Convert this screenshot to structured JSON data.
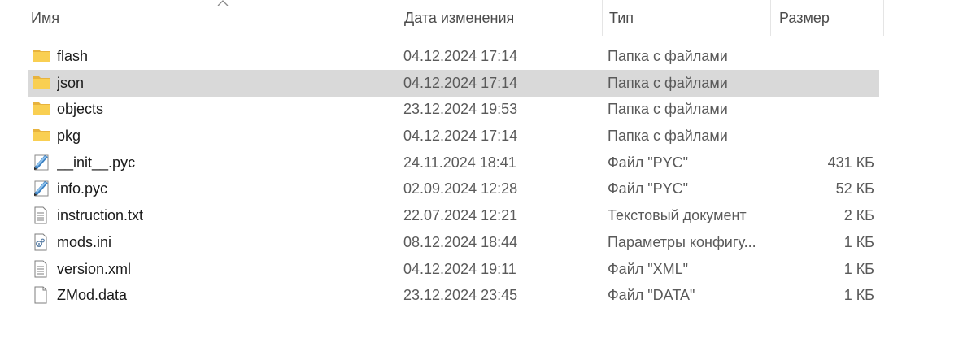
{
  "header": {
    "name": "Имя",
    "date": "Дата изменения",
    "type": "Тип",
    "size": "Размер"
  },
  "files": [
    {
      "name": "flash",
      "date": "04.12.2024 17:14",
      "type": "Папка с файлами",
      "size": "",
      "icon": "folder-icon",
      "selected": false
    },
    {
      "name": "json",
      "date": "04.12.2024 17:14",
      "type": "Папка с файлами",
      "size": "",
      "icon": "folder-icon",
      "selected": true
    },
    {
      "name": "objects",
      "date": "23.12.2024 19:53",
      "type": "Папка с файлами",
      "size": "",
      "icon": "folder-icon",
      "selected": false
    },
    {
      "name": "pkg",
      "date": "04.12.2024 17:14",
      "type": "Папка с файлами",
      "size": "",
      "icon": "folder-icon",
      "selected": false
    },
    {
      "name": "__init__.pyc",
      "date": "24.11.2024 18:41",
      "type": "Файл \"PYC\"",
      "size": "431 КБ",
      "icon": "pyc-file-icon",
      "selected": false
    },
    {
      "name": "info.pyc",
      "date": "02.09.2024 12:28",
      "type": "Файл \"PYC\"",
      "size": "52 КБ",
      "icon": "pyc-file-icon",
      "selected": false
    },
    {
      "name": "instruction.txt",
      "date": "22.07.2024 12:21",
      "type": "Текстовый документ",
      "size": "2 КБ",
      "icon": "text-file-icon",
      "selected": false
    },
    {
      "name": "mods.ini",
      "date": "08.12.2024 18:44",
      "type": "Параметры конфигу...",
      "size": "1 КБ",
      "icon": "settings-file-icon",
      "selected": false
    },
    {
      "name": "version.xml",
      "date": "04.12.2024 19:11",
      "type": "Файл \"XML\"",
      "size": "1 КБ",
      "icon": "text-file-icon",
      "selected": false
    },
    {
      "name": "ZMod.data",
      "date": "23.12.2024 23:45",
      "type": "Файл \"DATA\"",
      "size": "1 КБ",
      "icon": "blank-file-icon",
      "selected": false
    }
  ]
}
